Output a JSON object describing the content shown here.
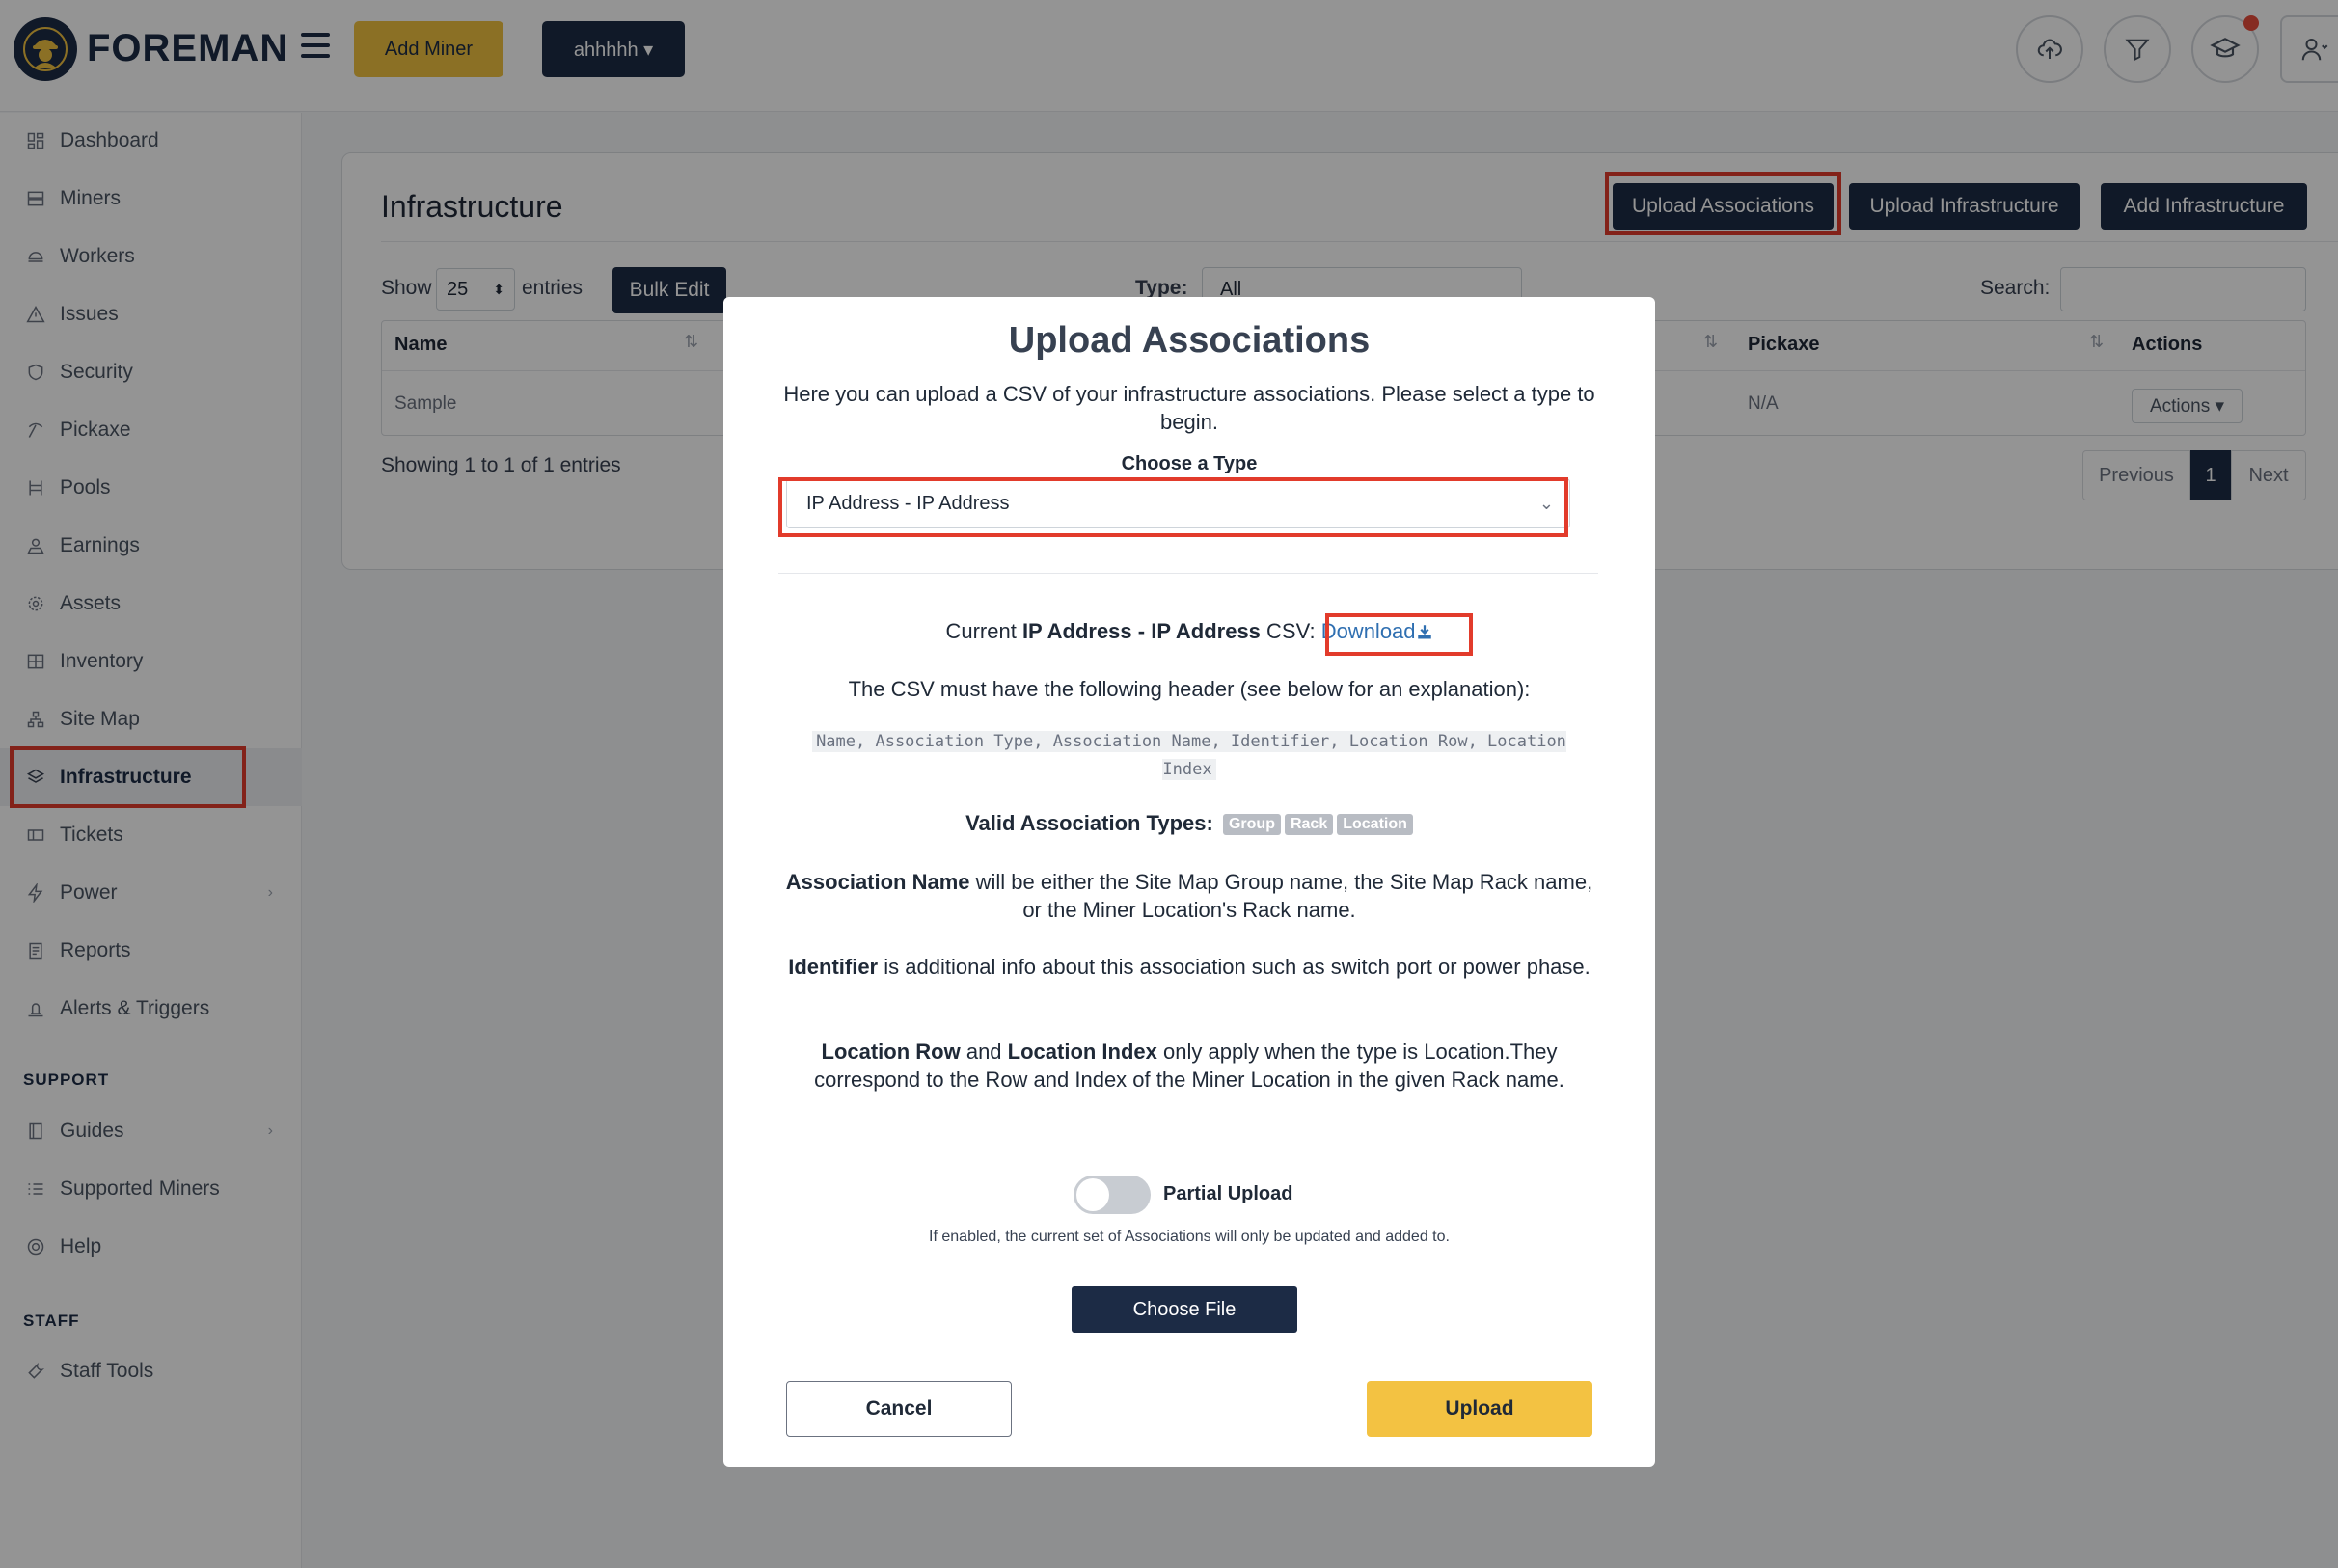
{
  "app": {
    "logo_text": "FOREMAN"
  },
  "topbar": {
    "add_miner_label": "Add Miner",
    "org_label": "ahhhhh ▾",
    "icons": [
      "upload-cloud-icon",
      "filter-icon",
      "graduation-cap-icon",
      "user-icon"
    ]
  },
  "sidebar": {
    "items": [
      {
        "label": "Dashboard",
        "icon": "dashboard-icon"
      },
      {
        "label": "Miners",
        "icon": "server-icon"
      },
      {
        "label": "Workers",
        "icon": "workers-icon"
      },
      {
        "label": "Issues",
        "icon": "warning-icon"
      },
      {
        "label": "Security",
        "icon": "shield-icon"
      },
      {
        "label": "Pickaxe",
        "icon": "pickaxe-icon"
      },
      {
        "label": "Pools",
        "icon": "pools-icon"
      },
      {
        "label": "Earnings",
        "icon": "earnings-icon"
      },
      {
        "label": "Assets",
        "icon": "gear-icon"
      },
      {
        "label": "Inventory",
        "icon": "inventory-icon"
      },
      {
        "label": "Site Map",
        "icon": "sitemap-icon"
      },
      {
        "label": "Infrastructure",
        "icon": "layers-icon",
        "active": true
      },
      {
        "label": "Tickets",
        "icon": "ticket-icon"
      },
      {
        "label": "Power",
        "icon": "bolt-icon",
        "has_submenu": true
      },
      {
        "label": "Reports",
        "icon": "report-icon"
      },
      {
        "label": "Alerts & Triggers",
        "icon": "alert-icon"
      }
    ],
    "support_heading": "SUPPORT",
    "support_items": [
      {
        "label": "Guides",
        "icon": "book-icon",
        "has_submenu": true
      },
      {
        "label": "Supported Miners",
        "icon": "list-icon"
      },
      {
        "label": "Help",
        "icon": "help-icon"
      }
    ],
    "staff_heading": "STAFF",
    "staff_items": [
      {
        "label": "Staff Tools",
        "icon": "tools-icon"
      }
    ]
  },
  "main": {
    "title": "Infrastructure",
    "buttons": {
      "upload_associations": "Upload Associations",
      "upload_infrastructure": "Upload Infrastructure",
      "add_infrastructure": "Add Infrastructure"
    },
    "show_label": "Show",
    "page_size": "25",
    "entries_label": "entries",
    "bulk_edit": "Bulk Edit",
    "type_label": "Type:",
    "type_value": "All",
    "search_label": "Search:",
    "table": {
      "headers": [
        "Name",
        "Pickaxe",
        "Actions"
      ],
      "rows": [
        {
          "name": "Sample",
          "pickaxe": "N/A",
          "actions": "Actions ▾"
        }
      ]
    },
    "showing": "Showing 1 to 1 of 1 entries",
    "pagination": {
      "previous": "Previous",
      "current": "1",
      "next": "Next"
    }
  },
  "modal": {
    "title": "Upload Associations",
    "description": "Here you can upload a CSV of your infrastructure associations. Please select a type to begin.",
    "choose_type_label": "Choose a Type",
    "selected_type": "IP Address - IP Address",
    "current_prefix": "Current ",
    "current_type": "IP Address - IP Address",
    "current_suffix": " CSV: ",
    "download_label": "Download",
    "must_have": "The CSV must have the following header (see below for an explanation):",
    "csv_header": "Name, Association Type, Association Name, Identifier, Location Row, Location Index",
    "valid_types_label": "Valid Association Types:",
    "valid_types": [
      "Group",
      "Rack",
      "Location"
    ],
    "assoc_name_term": "Association Name",
    "assoc_name_text": " will be either the Site Map Group name, the Site Map Rack name, or the Miner Location's Rack name.",
    "identifier_term": "Identifier",
    "identifier_text": " is additional info about this association such as switch port or power phase.",
    "loc_row_term": "Location Row",
    "loc_and": " and ",
    "loc_index_term": "Location Index",
    "loc_text": " only apply when the type is Location.They correspond to the Row and Index of the Miner Location in the given Rack name.",
    "partial_upload_label": "Partial Upload",
    "partial_upload_enabled": false,
    "partial_note": "If enabled, the current set of Associations will only be updated and added to.",
    "choose_file": "Choose File",
    "cancel": "Cancel",
    "upload": "Upload"
  },
  "colors": {
    "navy": "#1c2b45",
    "gold": "#f0c141",
    "highlight": "#e23b2b",
    "link": "#2f6fb1"
  }
}
